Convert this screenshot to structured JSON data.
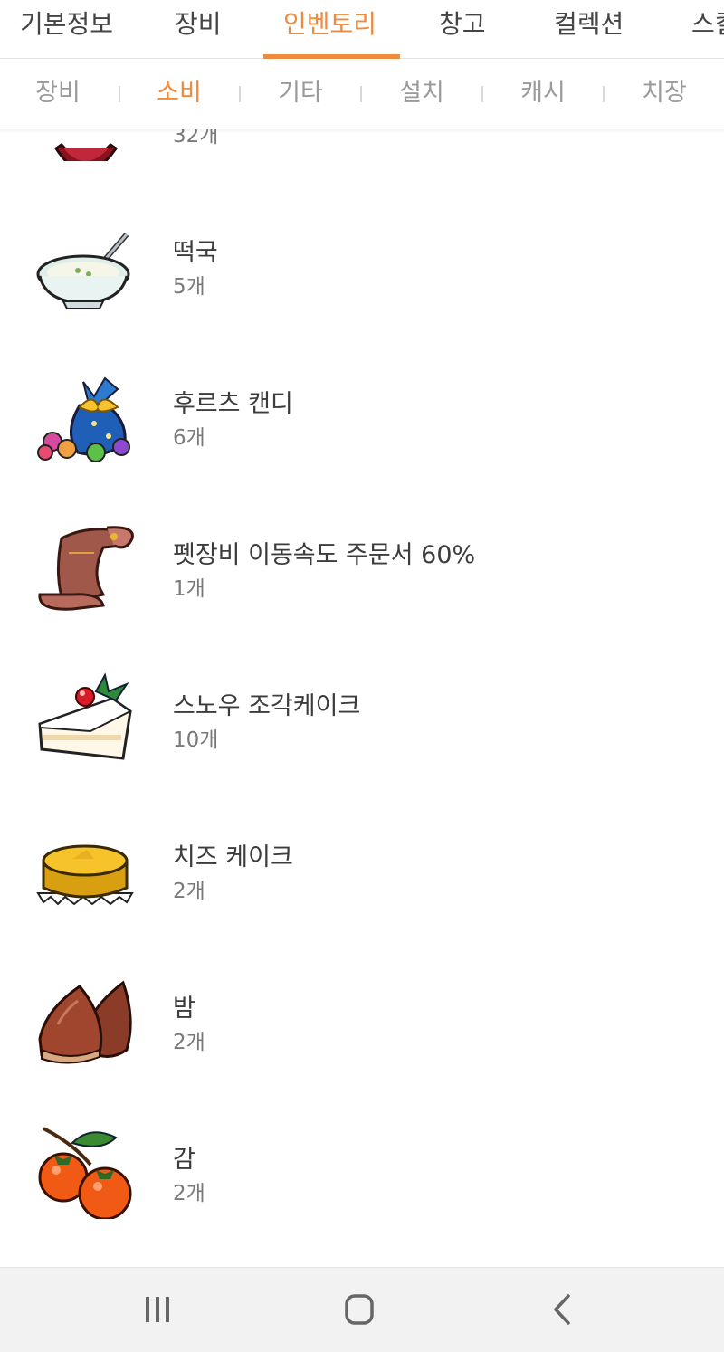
{
  "top_tabs": [
    {
      "label": "기본정보"
    },
    {
      "label": "장비"
    },
    {
      "label": "인벤토리",
      "active": true
    },
    {
      "label": "창고"
    },
    {
      "label": "컬렉션"
    },
    {
      "label": "스킬"
    }
  ],
  "sub_tabs": [
    {
      "label": "장비"
    },
    {
      "label": "소비",
      "active": true
    },
    {
      "label": "기타"
    },
    {
      "label": "설치"
    },
    {
      "label": "캐시"
    },
    {
      "label": "치장"
    }
  ],
  "items": [
    {
      "name": "",
      "count": "32개",
      "icon": "red-potion-icon"
    },
    {
      "name": "떡국",
      "count": "5개",
      "icon": "rice-cake-soup-icon"
    },
    {
      "name": "후르츠 캔디",
      "count": "6개",
      "icon": "fruit-candy-icon"
    },
    {
      "name": "펫장비 이동속도 주문서 60%",
      "count": "1개",
      "icon": "scroll-icon"
    },
    {
      "name": "스노우 조각케이크",
      "count": "10개",
      "icon": "snow-cake-icon"
    },
    {
      "name": "치즈 케이크",
      "count": "2개",
      "icon": "cheese-cake-icon"
    },
    {
      "name": "밤",
      "count": "2개",
      "icon": "chestnut-icon"
    },
    {
      "name": "감",
      "count": "2개",
      "icon": "persimmon-icon"
    }
  ],
  "navbar": {
    "recent_icon": "recent-apps-icon",
    "home_icon": "home-icon",
    "back_icon": "back-icon"
  },
  "colors": {
    "accent": "#f08a3c",
    "nav_background": "#f2f2f2"
  }
}
